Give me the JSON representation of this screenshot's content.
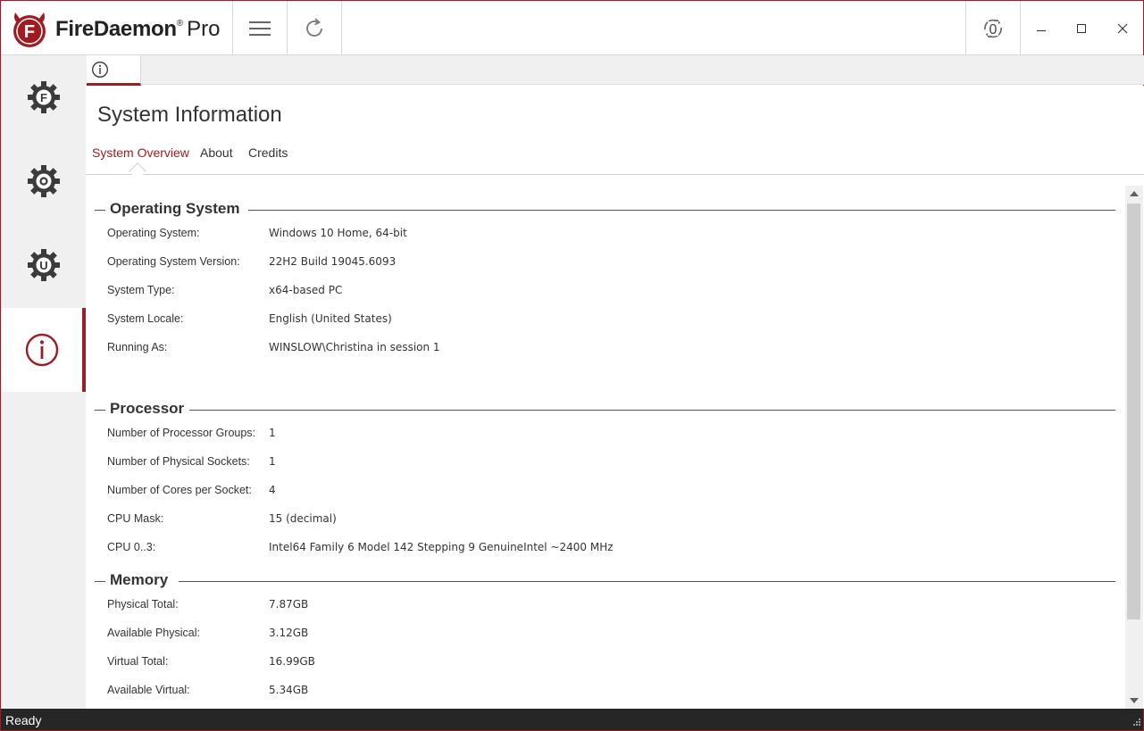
{
  "app": {
    "brand_name": "FireDaemon",
    "brand_mark": "®",
    "brand_edition": "Pro",
    "accent_color": "#a01c22"
  },
  "toolbar": {
    "menu_icon": "hamburger-icon",
    "refresh_icon": "refresh-icon",
    "sync_icon": "sync-counter-icon",
    "sync_count": "0"
  },
  "window_controls": [
    "minimize",
    "maximize",
    "close"
  ],
  "sidenav": {
    "items": [
      {
        "icon": "gear-f-icon",
        "active": false
      },
      {
        "icon": "gear-circle-icon",
        "active": false
      },
      {
        "icon": "gear-u-icon",
        "active": false
      },
      {
        "icon": "info-icon",
        "active": true
      }
    ]
  },
  "doc_tab": {
    "icon": "info-icon"
  },
  "page": {
    "title": "System Information",
    "tabs": [
      {
        "label": "System Overview",
        "active": true
      },
      {
        "label": "About",
        "active": false
      },
      {
        "label": "Credits",
        "active": false
      }
    ]
  },
  "sections": {
    "os": {
      "title": "Operating System",
      "rows": [
        {
          "label": "Operating System:",
          "value": "Windows 10 Home, 64-bit"
        },
        {
          "label": "Operating System Version:",
          "value": "22H2 Build 19045.6093"
        },
        {
          "label": "System Type:",
          "value": "x64-based PC"
        },
        {
          "label": "System Locale:",
          "value": "English (United States)"
        },
        {
          "label": "Running As:",
          "value": "WINSLOW\\Christina in session 1"
        }
      ]
    },
    "processor": {
      "title": "Processor",
      "rows": [
        {
          "label": "Number of Processor Groups:",
          "value": "1"
        },
        {
          "label": "Number of Physical Sockets:",
          "value": "1"
        },
        {
          "label": "Number of Cores per Socket:",
          "value": "4"
        },
        {
          "label": "CPU Mask:",
          "value": "15 (decimal)"
        },
        {
          "label": "CPU 0..3:",
          "value": "Intel64 Family 6 Model 142 Stepping 9 GenuineIntel ~2400 MHz"
        }
      ]
    },
    "memory": {
      "title": "Memory",
      "rows": [
        {
          "label": "Physical Total:",
          "value": "7.87GB"
        },
        {
          "label": "Available Physical:",
          "value": "3.12GB"
        },
        {
          "label": "Virtual Total:",
          "value": "16.99GB"
        },
        {
          "label": "Available Virtual:",
          "value": "5.34GB"
        }
      ]
    }
  },
  "status": {
    "text": "Ready"
  }
}
